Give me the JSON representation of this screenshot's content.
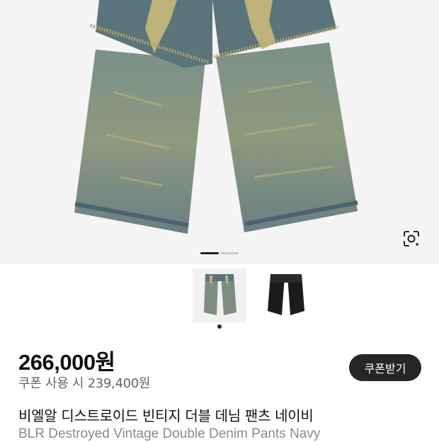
{
  "product": {
    "price": "266,000원",
    "coupon_price": "쿠폰 사용 시 239,400원",
    "coupon_button": "쿠폰받기",
    "name_ko": "비엘알 디스트로이드 빈티지 더블 데님 팬츠 네이비",
    "name_en": "BLR Destroyed Vintage Double Denim Pants Navy"
  },
  "gallery": {
    "total_images": 2,
    "current_image": 1,
    "thumbnails": [
      {
        "name": "denim-vintage-thumbnail",
        "selected": true
      },
      {
        "name": "black-pants-thumbnail",
        "selected": false
      }
    ]
  },
  "icons": {
    "lens": "lens-search-icon"
  },
  "colors": {
    "background": "#ffffff",
    "hero_bg": "#f4f4f4",
    "button_bg": "#262626",
    "button_text": "#ffffff",
    "muted_text": "#666666",
    "en_title_text": "#8a8a8a",
    "dot_active": "#222222",
    "dot_inactive": "#cccccc",
    "denim_base": "#6f8a85",
    "denim_highlight": "#c9b87a"
  }
}
